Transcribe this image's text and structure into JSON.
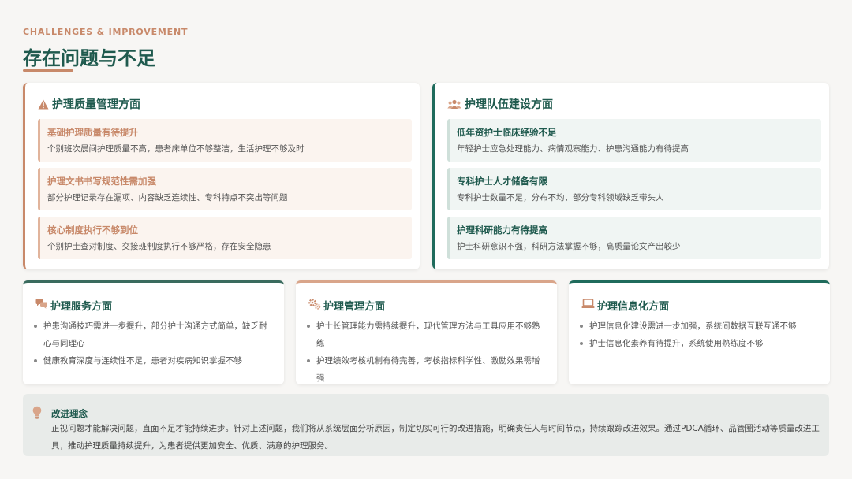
{
  "header": {
    "subtitle": "CHALLENGES & IMPROVEMENT",
    "title": "存在问题与不足"
  },
  "colors": {
    "primary": "#1f5a4e",
    "accent": "#c8896a"
  },
  "quality_card": {
    "icon": "warning-icon",
    "title": "护理质量管理方面",
    "items": [
      {
        "title": "基础护理质量有待提升",
        "desc": "个别班次晨间护理质量不高，患者床单位不够整洁，生活护理不够及时"
      },
      {
        "title": "护理文书书写规范性需加强",
        "desc": "部分护理记录存在漏项、内容缺乏连续性、专科特点不突出等问题"
      },
      {
        "title": "核心制度执行不够到位",
        "desc": "个别护士查对制度、交接班制度执行不够严格，存在安全隐患"
      }
    ]
  },
  "team_card": {
    "icon": "team-icon",
    "title": "护理队伍建设方面",
    "items": [
      {
        "title": "低年资护士临床经验不足",
        "desc": "年轻护士应急处理能力、病情观察能力、护患沟通能力有待提高"
      },
      {
        "title": "专科护士人才储备有限",
        "desc": "专科护士数量不足，分布不均，部分专科领域缺乏带头人"
      },
      {
        "title": "护理科研能力有待提高",
        "desc": "护士科研意识不强，科研方法掌握不够，高质量论文产出较少"
      }
    ]
  },
  "service_card": {
    "icon": "chat-icon",
    "title": "护理服务方面",
    "bullets": [
      "护患沟通技巧需进一步提升，部分护士沟通方式简单，缺乏耐心与同理心",
      "健康教育深度与连续性不足，患者对疾病知识掌握不够"
    ]
  },
  "management_card": {
    "icon": "gears-icon",
    "title": "护理管理方面",
    "bullets": [
      "护士长管理能力需持续提升，现代管理方法与工具应用不够熟练",
      "护理绩效考核机制有待完善，考核指标科学性、激励效果需增强"
    ]
  },
  "it_card": {
    "icon": "laptop-icon",
    "title": "护理信息化方面",
    "bullets": [
      "护理信息化建设需进一步加强，系统间数据互联互通不够",
      "护士信息化素养有待提升，系统使用熟练度不够"
    ]
  },
  "improvement": {
    "icon": "lightbulb-icon",
    "title": "改进理念",
    "text": "正视问题才能解决问题，直面不足才能持续进步。针对上述问题，我们将从系统层面分析原因，制定切实可行的改进措施，明确责任人与时间节点，持续跟踪改进效果。通过PDCA循环、品管圈活动等质量改进工具，推动护理质量持续提升，为患者提供更加安全、优质、满意的护理服务。"
  }
}
